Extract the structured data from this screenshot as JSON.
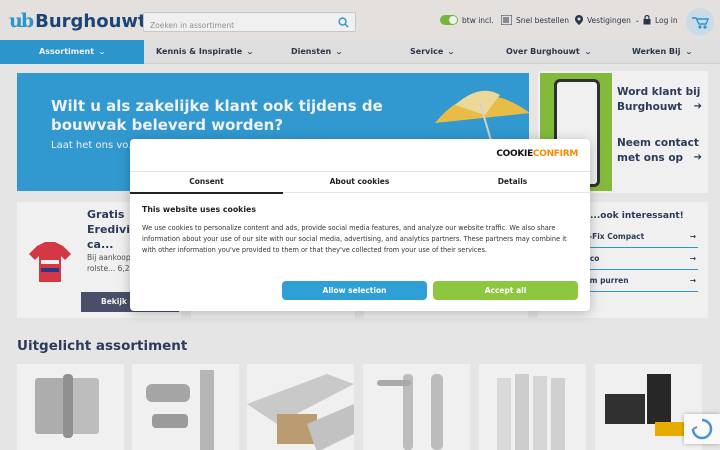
{
  "header": {
    "logo_mark": "ub",
    "logo_text": "Burghouwt",
    "search_placeholder": "Zoeken in assortiment",
    "vat_label": "btw incl.",
    "quick_order": "Snel bestellen",
    "branches": "Vestigingen",
    "login": "Log in"
  },
  "nav": {
    "items": [
      "Assortiment",
      "Kennis & Inspiratie",
      "Diensten",
      "Service",
      "Over Burghouwt",
      "Werken Bij"
    ]
  },
  "hero": {
    "title": "Wilt u als zakelijke klant ook tijdens de bouwvak beleverd worden?",
    "subtitle": "Laat het ons vo... wij rekening met..."
  },
  "side_card": {
    "link1": "Word klant bij Burghouwt",
    "link2": "Neem contact met ons op"
  },
  "promo": {
    "title": "Gratis Eredivi... shirt ca...",
    "text": "Bij aankoop... Altrex rolste... 6,20 meter.",
    "button": "Bekijk a..."
  },
  "links_card": {
    "title": "...ook interessant!",
    "items": [
      "...Hahn KT-Fix Compact",
      "...ngen Duco",
      "...Duurzaam purren"
    ]
  },
  "featured": {
    "title": "Uitgelicht assortiment"
  },
  "cookie": {
    "logo_a": "COOKIE",
    "logo_b": "CONFIRM",
    "tabs": [
      "Consent",
      "About cookies",
      "Details"
    ],
    "heading": "This website uses cookies",
    "body": "We use cookies to personalize content and ads, provide social media features, and analyze our website traffic. We also share information about your use of our site with our social media, advertising, and analytics partners. These partners may combine it with other information you've provided to them or that they've collected from your use of their services.",
    "allow_selection": "Allow selection",
    "accept_all": "Accept all"
  },
  "colors": {
    "brand_blue": "#2f9fd8",
    "brand_green": "#8dc63f",
    "navy": "#2e3f5f"
  }
}
